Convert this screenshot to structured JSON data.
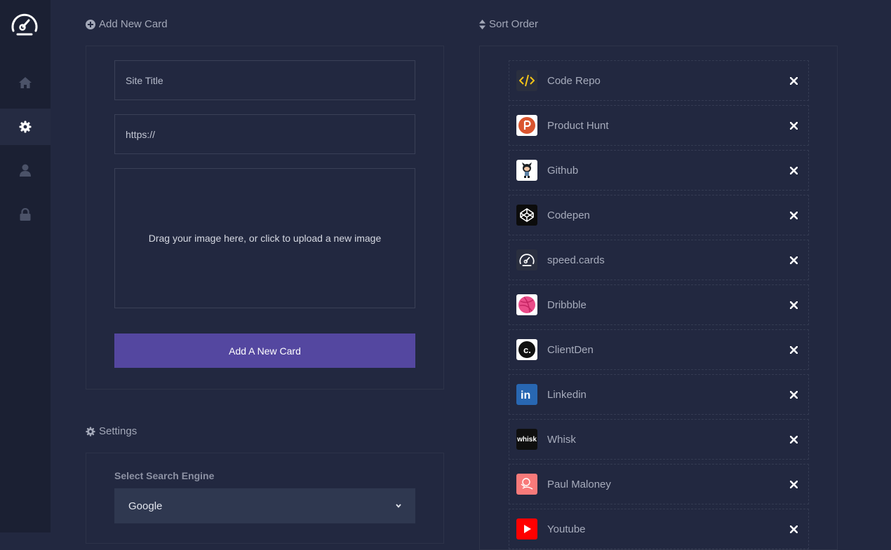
{
  "sidebar": {
    "items": [
      {
        "name": "home"
      },
      {
        "name": "settings",
        "active": true
      },
      {
        "name": "profile"
      },
      {
        "name": "lock"
      }
    ]
  },
  "add_card": {
    "title": "Add New Card",
    "site_title_placeholder": "Site Title",
    "url_value": "https://",
    "dropzone_text": "Drag your image here, or click to upload a new image",
    "button_label": "Add A New Card"
  },
  "settings": {
    "title": "Settings",
    "search_engine_label": "Select Search Engine",
    "search_engine_value": "Google"
  },
  "sort_order": {
    "title": "Sort Order",
    "items": [
      {
        "label": "Code Repo",
        "icon": "code-icon",
        "icon_bg": "#2a2f3f"
      },
      {
        "label": "Product Hunt",
        "icon": "product-hunt-icon",
        "icon_bg": "#ffffff"
      },
      {
        "label": "Github",
        "icon": "github-icon",
        "icon_bg": "#ffffff"
      },
      {
        "label": "Codepen",
        "icon": "codepen-icon",
        "icon_bg": "#0c0c0c"
      },
      {
        "label": "speed.cards",
        "icon": "speed-cards-icon",
        "icon_bg": "#2a2f3f"
      },
      {
        "label": "Dribbble",
        "icon": "dribbble-icon",
        "icon_bg": "#ffffff"
      },
      {
        "label": "ClientDen",
        "icon": "clientden-icon",
        "icon_bg": "#ffffff"
      },
      {
        "label": "Linkedin",
        "icon": "linkedin-icon",
        "icon_bg": "#2867b2"
      },
      {
        "label": "Whisk",
        "icon": "whisk-icon",
        "icon_bg": "#0f0f0f",
        "icon_text": "whisk"
      },
      {
        "label": "Paul Maloney",
        "icon": "paul-maloney-icon",
        "icon_bg": "#f87a7a"
      },
      {
        "label": "Youtube",
        "icon": "youtube-icon",
        "icon_bg": "#ff0000"
      }
    ]
  },
  "colors": {
    "background": "#222840",
    "sidebar": "#1b2033",
    "accent_button": "#5447a0"
  }
}
